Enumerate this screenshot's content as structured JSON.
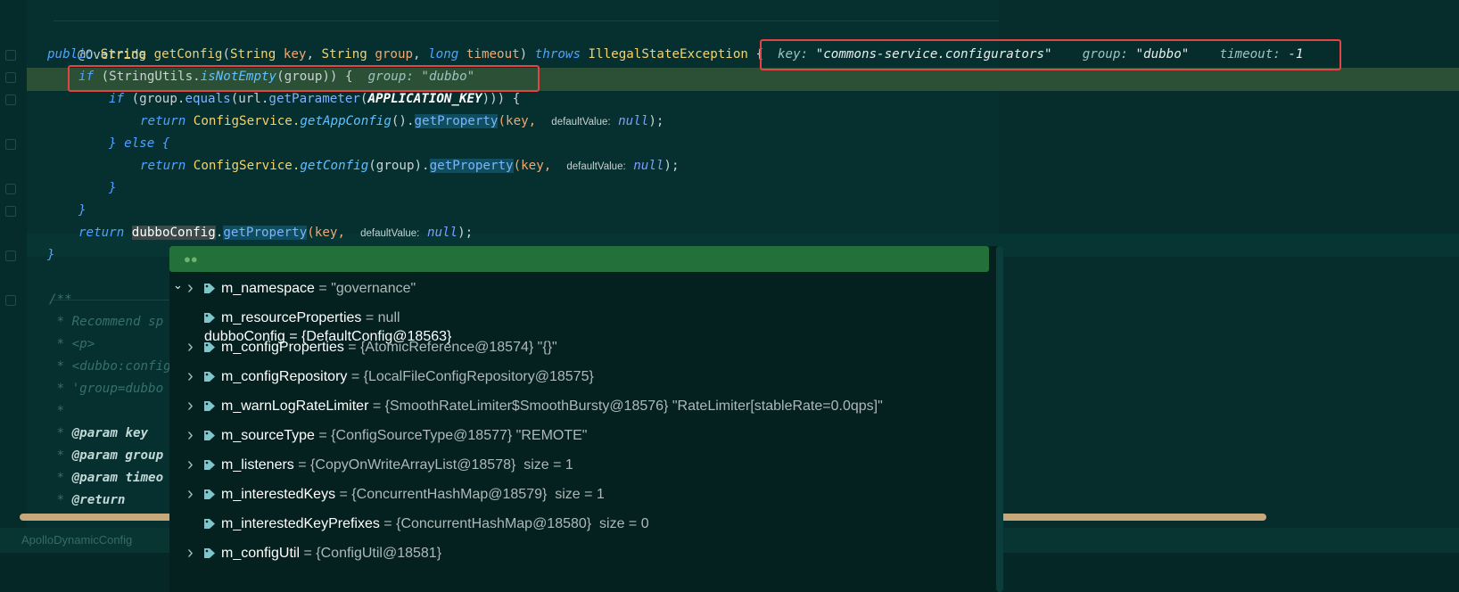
{
  "code": {
    "annotation": "@Override",
    "sig": {
      "public": "public",
      "string": "String",
      "method": "getConfig",
      "open": "(",
      "string2": "String",
      "p1": "key",
      "comma1": ", ",
      "string3": "String",
      "p2": "group",
      "comma2": ", ",
      "long": "long",
      "p3": "timeout",
      "close": ") ",
      "throws": "throws",
      "exc": "IllegalStateException",
      "brace": " {"
    },
    "sig_inline": {
      "k1": "key:",
      "v1": "\"commons-service.configurators\"",
      "k2": "group:",
      "v2": "\"dubbo\"",
      "k3": "timeout:",
      "v3": "-1"
    },
    "line_if": {
      "if": "if",
      "a": " (StringUtils.",
      "m": "isNotEmpty",
      "b": "(group)) {",
      "ik": "group:",
      "iv": "\"dubbo\""
    },
    "line_if2": {
      "if": "if",
      "a": " (group.",
      "m1": "equals",
      "b": "(url.",
      "m2": "getParameter",
      "c": "(",
      "k": "APPLICATION_KEY",
      "d": "))) {"
    },
    "line_ret1": {
      "ret": "return",
      "cls": "ConfigService.",
      "m1": "getAppConfig",
      "a": "().",
      "m2": "getProperty",
      "b": "(key,",
      "hint": "defaultValue:",
      "nul": "null",
      "end": ");"
    },
    "line_else": {
      "text": "} else {"
    },
    "line_ret2": {
      "ret": "return",
      "cls": "ConfigService.",
      "m1": "getConfig",
      "a": "(group).",
      "m2": "getProperty",
      "b": "(key,",
      "hint": "defaultValue:",
      "nul": "null",
      "end": ");"
    },
    "brace_inner": "}",
    "brace_if": "}",
    "line_ret3": {
      "ret": "return",
      "sel": "dubboConfig",
      "a": ".",
      "m": "getProperty",
      "b": "(key,",
      "hint": "defaultValue:",
      "nul": "null",
      "end": ");"
    },
    "brace_method": "}",
    "comments": [
      "/**",
      " * Recommend sp",
      " * <p>",
      " * <dubbo:config",
      " * 'group=dubbo",
      " *"
    ],
    "params": [
      {
        "star": " * ",
        "tag": "@param",
        "name": " key"
      },
      {
        "star": " * ",
        "tag": "@param",
        "name": " group"
      },
      {
        "star": " * ",
        "tag": "@param",
        "name": " timeo"
      },
      {
        "star": " * ",
        "tag": "@return",
        "name": ""
      }
    ]
  },
  "status": {
    "class_name": "ApolloDynamicConfig"
  },
  "debug_popup": {
    "root": {
      "name": "dubboConfig",
      "value": " = {DefaultConfig@18563}"
    },
    "fields": [
      {
        "name": "m_namespace",
        "value": " = \"governance\"",
        "expandable": true
      },
      {
        "name": "m_resourceProperties",
        "value": " = null",
        "expandable": false
      },
      {
        "name": "m_configProperties",
        "value": " = {AtomicReference@18574} \"{}\"",
        "expandable": true
      },
      {
        "name": "m_configRepository",
        "value": " = {LocalFileConfigRepository@18575}",
        "expandable": true
      },
      {
        "name": "m_warnLogRateLimiter",
        "value": " = {SmoothRateLimiter$SmoothBursty@18576} \"RateLimiter[stableRate=0.0qps]\"",
        "expandable": true
      },
      {
        "name": "m_sourceType",
        "value": " = {ConfigSourceType@18577} \"REMOTE\"",
        "expandable": true
      },
      {
        "name": "m_listeners",
        "value": " = {CopyOnWriteArrayList@18578}  size = 1",
        "expandable": true
      },
      {
        "name": "m_interestedKeys",
        "value": " = {ConcurrentHashMap@18579}  size = 1",
        "expandable": true
      },
      {
        "name": "m_interestedKeyPrefixes",
        "value": " = {ConcurrentHashMap@18580}  size = 0",
        "expandable": false
      },
      {
        "name": "m_configUtil",
        "value": " = {ConfigUtil@18581}",
        "expandable": true
      }
    ]
  },
  "colors": {
    "highlight_line": "#2b5035",
    "popup_selected": "#23703a",
    "red_box": "#e34444"
  }
}
